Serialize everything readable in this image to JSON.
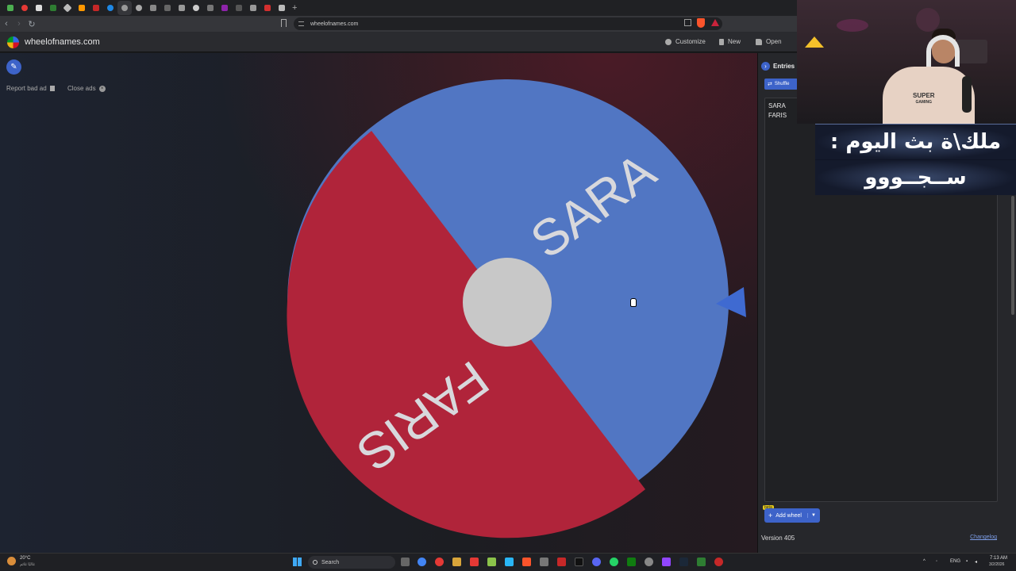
{
  "browser": {
    "url": "wheelofnames.com",
    "new_tab_glyph": "+"
  },
  "header": {
    "site_name": "wheelofnames.com",
    "menu": [
      {
        "label": "Customize",
        "icon": "palette-icon"
      },
      {
        "label": "New",
        "icon": "file-icon"
      },
      {
        "label": "Open",
        "icon": "folder-icon"
      }
    ]
  },
  "stage": {
    "report_ad": "Report bad ad",
    "close_ads": "Close ads"
  },
  "wheel": {
    "segments": [
      {
        "label": "SARA",
        "color": "#5176c3"
      },
      {
        "label": "FARIS",
        "color": "#b0243a"
      }
    ],
    "hub_color": "#c8c8c8",
    "pointer_color": "#3f6ad1"
  },
  "panel": {
    "tab_label": "Entries",
    "count": "2",
    "shuffle_label": "Shuffle",
    "entries": [
      "SARA",
      "FARIS"
    ],
    "beta_badge": "beta",
    "add_wheel_label": "Add wheel",
    "version": "Version 405",
    "changelog": "Changelog"
  },
  "webcam": {
    "shirt_line1": "SUPER",
    "shirt_line2": "GAMING"
  },
  "banner": {
    "line1": "ملك\\ة بث اليوم :",
    "line2": "ســجــووو"
  },
  "taskbar": {
    "weather_temp": "20°C",
    "weather_desc": "غالبًا غائم",
    "search_placeholder": "Search",
    "language": "ENG",
    "time": "7:13 AM",
    "date": "3/2/2026"
  },
  "colors": {
    "accent": "#3d63c9",
    "wheel_blue": "#5176c3",
    "wheel_red": "#b0243a"
  }
}
